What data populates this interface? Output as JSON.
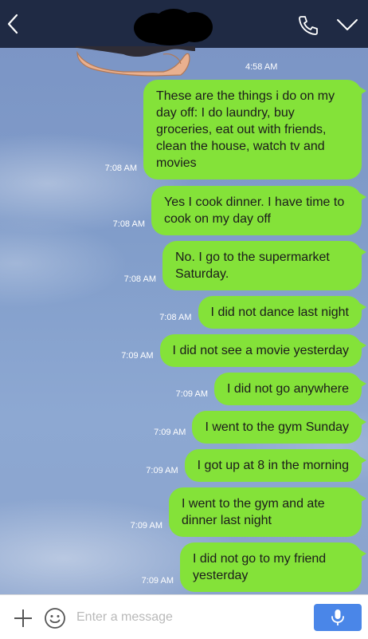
{
  "header": {
    "icons": [
      "back-icon",
      "phone-icon",
      "chevron-down-icon"
    ]
  },
  "sticker": {
    "time": "4:58 AM"
  },
  "messages": [
    {
      "time": "7:08 AM",
      "text": "These are the things i do on my day off: I do laundry, buy groceries, eat out with friends, clean the house, watch tv and movies"
    },
    {
      "time": "7:08 AM",
      "text": "Yes I cook dinner. I have time to cook on my day off"
    },
    {
      "time": "7:08 AM",
      "text": "No. I go to the supermarket Saturday."
    },
    {
      "time": "7:08 AM",
      "text": "I did not dance last night"
    },
    {
      "time": "7:09 AM",
      "text": "I did not see a movie yesterday"
    },
    {
      "time": "7:09 AM",
      "text": "I did not go anywhere"
    },
    {
      "time": "7:09 AM",
      "text": "I went to the gym Sunday"
    },
    {
      "time": "7:09 AM",
      "text": "I got up at 8 in the morning"
    },
    {
      "time": "7:09 AM",
      "text": "I went to the gym and ate dinner last night"
    },
    {
      "time": "7:09 AM",
      "text": "I did not go to my friend yesterday"
    }
  ],
  "footer": {
    "placeholder": "Enter a message",
    "icons": [
      "plus-icon",
      "emoji-icon",
      "microphone-icon"
    ]
  },
  "colors": {
    "header": "#1f2a44",
    "bubble": "#84e239",
    "mic_button": "#4a86e8"
  }
}
